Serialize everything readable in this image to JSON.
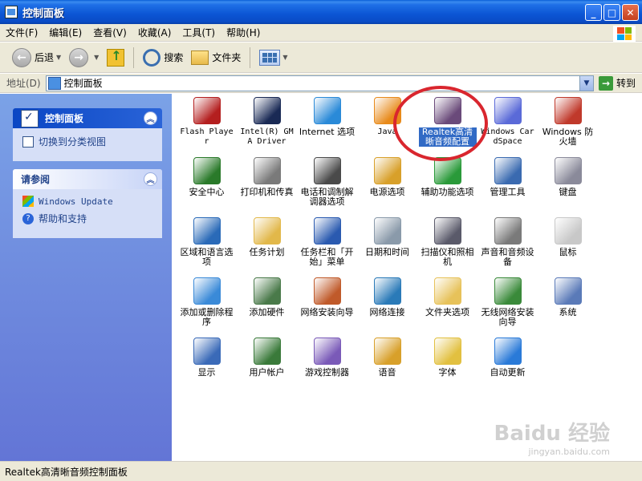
{
  "window": {
    "title": "控制面板",
    "icon": "control-panel-icon"
  },
  "menubar": [
    "文件(F)",
    "编辑(E)",
    "查看(V)",
    "收藏(A)",
    "工具(T)",
    "帮助(H)"
  ],
  "toolbar": {
    "back_label": "后退",
    "search_label": "搜索",
    "folders_label": "文件夹"
  },
  "address": {
    "label": "地址(D)",
    "value": "控制面板",
    "go_label": "转到"
  },
  "leftpane": {
    "panel1": {
      "title": "控制面板",
      "task": "切换到分类视图"
    },
    "panel2": {
      "title": "请参阅",
      "items": [
        "Windows Update",
        "帮助和支持"
      ]
    }
  },
  "items": [
    {
      "label": "Flash Player",
      "icon": "flash-icon",
      "color": "#b41f1f"
    },
    {
      "label": "Intel(R) GMA Driver",
      "icon": "monitor-icon",
      "color": "#1a2a55"
    },
    {
      "label": "Internet 选项",
      "icon": "globe-icon",
      "color": "#2a8ad8"
    },
    {
      "label": "Java",
      "icon": "java-icon",
      "color": "#e88a1a"
    },
    {
      "label": "Realtek高清晰音频配置",
      "icon": "speaker-icon",
      "color": "#6a4a7a"
    },
    {
      "label": "Windows CardSpace",
      "icon": "cardspace-icon",
      "color": "#5a6ad8"
    },
    {
      "label": "Windows 防火墙",
      "icon": "firewall-icon",
      "color": "#c0392b"
    },
    {
      "label": "安全中心",
      "icon": "shield-icon",
      "color": "#2a7a2a"
    },
    {
      "label": "打印机和传真",
      "icon": "printer-icon",
      "color": "#7a7a7a"
    },
    {
      "label": "电话和调制解调器选项",
      "icon": "phone-icon",
      "color": "#4a4a4a"
    },
    {
      "label": "电源选项",
      "icon": "power-icon",
      "color": "#d8a02a"
    },
    {
      "label": "辅助功能选项",
      "icon": "accessibility-icon",
      "color": "#2a9a3a"
    },
    {
      "label": "管理工具",
      "icon": "tools-icon",
      "color": "#3a6ab0"
    },
    {
      "label": "键盘",
      "icon": "keyboard-icon",
      "color": "#8a8a9a"
    },
    {
      "label": "区域和语言选项",
      "icon": "globe-region-icon",
      "color": "#2a6ab8"
    },
    {
      "label": "任务计划",
      "icon": "scheduled-tasks-icon",
      "color": "#e2b84a"
    },
    {
      "label": "任务栏和「开始」菜单",
      "icon": "taskbar-icon",
      "color": "#2a5ab0"
    },
    {
      "label": "日期和时间",
      "icon": "clock-icon",
      "color": "#8a9aaa"
    },
    {
      "label": "扫描仪和照相机",
      "icon": "scanner-icon",
      "color": "#5a5a6a"
    },
    {
      "label": "声音和音频设备",
      "icon": "sound-icon",
      "color": "#7a7a7a"
    },
    {
      "label": "鼠标",
      "icon": "mouse-icon",
      "color": "#c8c8c8"
    },
    {
      "label": "添加或删除程序",
      "icon": "add-remove-icon",
      "color": "#3a8ad8"
    },
    {
      "label": "添加硬件",
      "icon": "hardware-icon",
      "color": "#4a7a4a"
    },
    {
      "label": "网络安装向导",
      "icon": "home-network-icon",
      "color": "#c05a2a"
    },
    {
      "label": "网络连接",
      "icon": "network-icon",
      "color": "#2a7ab8"
    },
    {
      "label": "文件夹选项",
      "icon": "folder-options-icon",
      "color": "#e7c25a"
    },
    {
      "label": "无线网络安装向导",
      "icon": "wireless-icon",
      "color": "#3a8a3a"
    },
    {
      "label": "系统",
      "icon": "system-icon",
      "color": "#5a7ab8"
    },
    {
      "label": "显示",
      "icon": "display-icon",
      "color": "#3a6ab8"
    },
    {
      "label": "用户帐户",
      "icon": "users-icon",
      "color": "#3a7a3a"
    },
    {
      "label": "游戏控制器",
      "icon": "gamepad-icon",
      "color": "#7a5ab8"
    },
    {
      "label": "语音",
      "icon": "speech-icon",
      "color": "#d8a02a"
    },
    {
      "label": "字体",
      "icon": "fonts-icon",
      "color": "#e2c040"
    },
    {
      "label": "自动更新",
      "icon": "windows-update-icon",
      "color": "#2a7ad8"
    }
  ],
  "selected_index": 4,
  "statusbar": {
    "text": "Realtek高清晰音频控制面板"
  },
  "watermark": {
    "text": "Baidu 经验",
    "sub": "jingyan.baidu.com"
  }
}
